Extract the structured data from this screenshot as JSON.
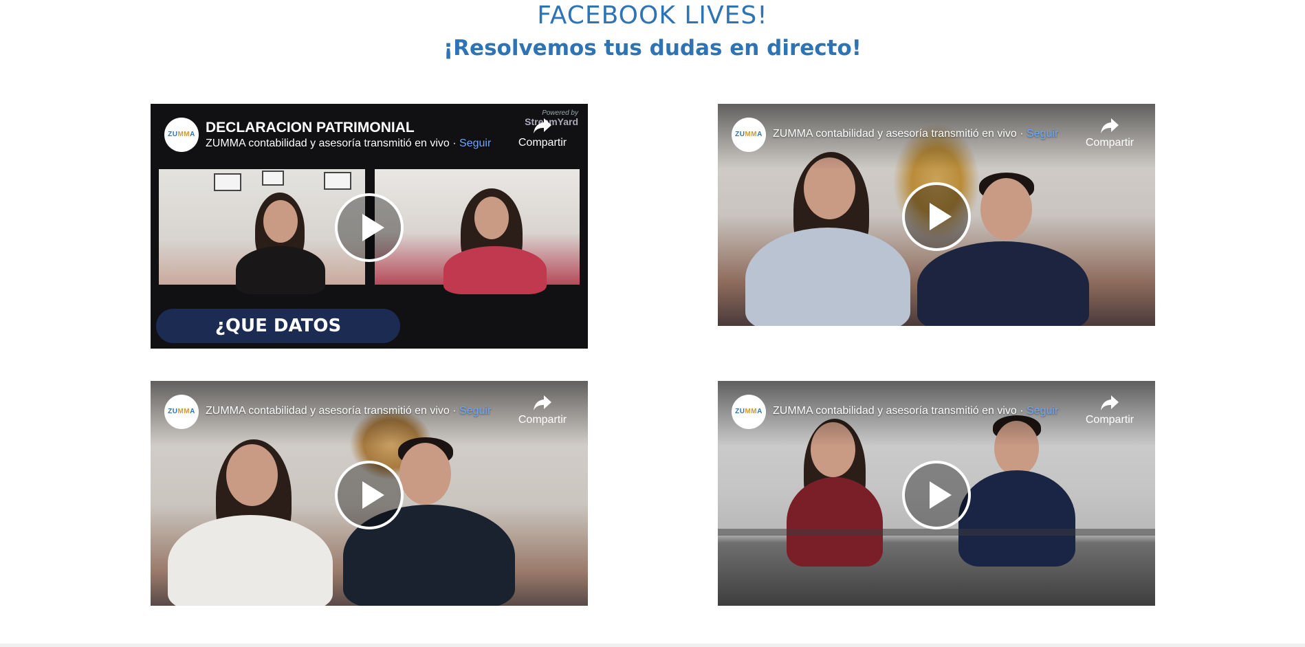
{
  "page": {
    "title": "FACEBOOK LIVES!",
    "subtitle": "¡Resolvemos tus dudas en directo!"
  },
  "colors": {
    "heading": "#2e73b3",
    "follow_link": "#6aa9ff",
    "pill_bg": "#1c2b52"
  },
  "avatar_text": "ZUMMA",
  "videos": [
    {
      "title": "DECLARACION PATRIMONIAL",
      "byline": "ZUMMA contabilidad y asesoría transmitió en vivo · ",
      "follow": "Seguir",
      "share": "Compartir",
      "powered_by": "Powered by",
      "powered_brand": "StreamYard",
      "overlay_text": "¿QUE DATOS CONTIENE?"
    },
    {
      "byline": "ZUMMA contabilidad y asesoría transmitió en vivo · ",
      "follow": "Seguir",
      "share": "Compartir"
    },
    {
      "byline": "ZUMMA contabilidad y asesoría transmitió en vivo · ",
      "follow": "Seguir",
      "share": "Compartir"
    },
    {
      "byline": "ZUMMA contabilidad y asesoría transmitió en vivo · ",
      "follow": "Seguir",
      "share": "Compartir"
    }
  ],
  "icons": {
    "play": "play-icon",
    "share": "share-arrow-icon"
  }
}
